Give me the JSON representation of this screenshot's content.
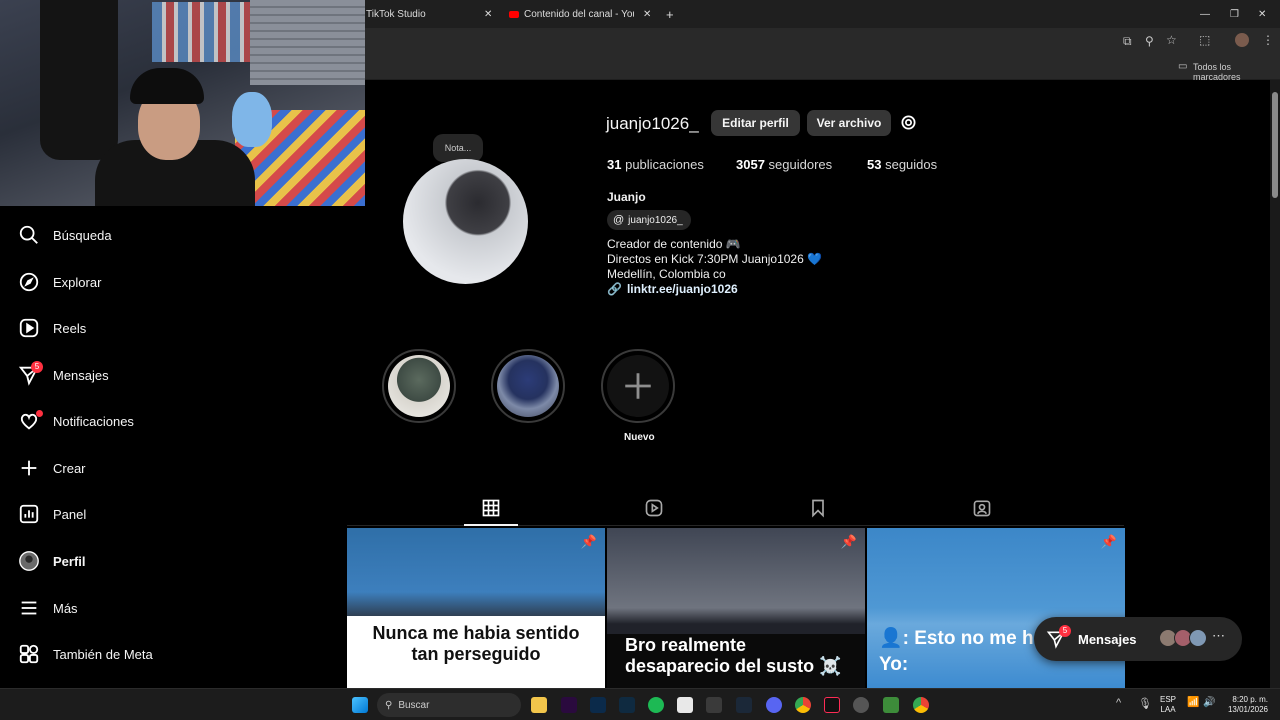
{
  "browser": {
    "tabs": [
      {
        "label": "TikTok Studio"
      },
      {
        "label": "Contenido del canal - YouTube"
      }
    ],
    "bookmarks_label": "Todos los marcadores"
  },
  "sidebar": {
    "items": [
      {
        "label": "Búsqueda",
        "icon": "search-icon"
      },
      {
        "label": "Explorar",
        "icon": "compass-icon"
      },
      {
        "label": "Reels",
        "icon": "reels-icon"
      },
      {
        "label": "Mensajes",
        "icon": "messenger-icon",
        "badge": "5"
      },
      {
        "label": "Notificaciones",
        "icon": "heart-icon"
      },
      {
        "label": "Crear",
        "icon": "plus-icon"
      },
      {
        "label": "Panel",
        "icon": "dashboard-icon"
      },
      {
        "label": "Perfil",
        "icon": "avatar-icon"
      },
      {
        "label": "Más",
        "icon": "menu-icon"
      },
      {
        "label": "También de Meta",
        "icon": "meta-icon"
      }
    ]
  },
  "profile": {
    "note": "Nota...",
    "username": "juanjo1026_",
    "edit_button": "Editar perfil",
    "archive_button": "Ver archivo",
    "posts_count": "31",
    "posts_label": "publicaciones",
    "followers_count": "3057",
    "followers_label": "seguidores",
    "following_count": "53",
    "following_label": "seguidos",
    "name": "Juanjo",
    "threads_handle": "juanjo1026_",
    "bio_line1": "Creador de contenido 🎮",
    "bio_line2": "Directos en Kick 7:30PM Juanjo1026 💙",
    "bio_line3": "Medellín, Colombia co",
    "link": "linktr.ee/juanjo1026"
  },
  "highlights": {
    "new_label": "Nuevo"
  },
  "posts": [
    {
      "caption_line1": "Nunca me habia sentido",
      "caption_line2": "tan perseguido"
    },
    {
      "caption_line1": "Bro realmente",
      "caption_line2": "desaparecio del susto ☠️"
    },
    {
      "caption_line1": "👤: Esto no me h",
      "caption_line2": "Yo:"
    }
  ],
  "messages_pill": {
    "label": "Mensajes",
    "badge": "5"
  },
  "taskbar": {
    "search_placeholder": "Buscar",
    "lang_line1": "ESP",
    "lang_line2": "LAA",
    "time": "8:20 p. m.",
    "date": "13/01/2026"
  },
  "colors": {
    "background": "#000000",
    "button": "#363636",
    "badge": "#ff3040",
    "chrome": "#292929"
  }
}
